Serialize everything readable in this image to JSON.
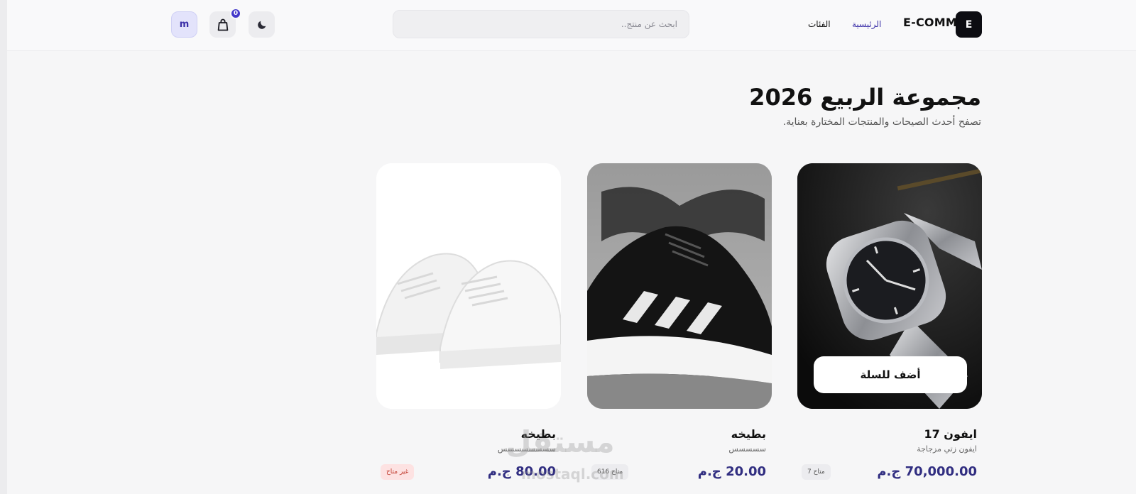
{
  "header": {
    "logo_letter": "E",
    "brand": "E-COMM",
    "nav": {
      "home": "الرئيسية",
      "categories": "الفئات"
    },
    "search_placeholder": "ابحث عن منتج..",
    "cart_count": "0",
    "user_initial": "m",
    "icons": {
      "theme": "moon-icon",
      "cart": "shopping-bag-icon"
    },
    "accent_color": "#3b2fa8"
  },
  "hero": {
    "title": "مجموعة الربيع 2026",
    "subtitle": "تصفح أحدث الصيحات والمنتجات المختارة بعناية."
  },
  "products": [
    {
      "name": "ايفون 17",
      "desc": "ايفون زتي مزجاجة",
      "price": "70,000.00 ج.م",
      "stock": "متاح 7",
      "stock_status": "in-stock",
      "add_to_cart": "أضف للسلة",
      "image": "silver-watch"
    },
    {
      "name": "بطيخه",
      "desc": "سسسسس",
      "price": "20.00 ج.م",
      "stock": "متاح 616",
      "stock_status": "in-stock",
      "image": "black-sneaker"
    },
    {
      "name": "بطيخه",
      "desc": "سسسسسسسس",
      "price": "80.00 ج.م",
      "stock": "غير متاح",
      "stock_status": "out-of-stock",
      "image": "white-sneakers"
    }
  ],
  "watermark": {
    "arabic": "مستقل",
    "latin": "mostaql.com"
  }
}
